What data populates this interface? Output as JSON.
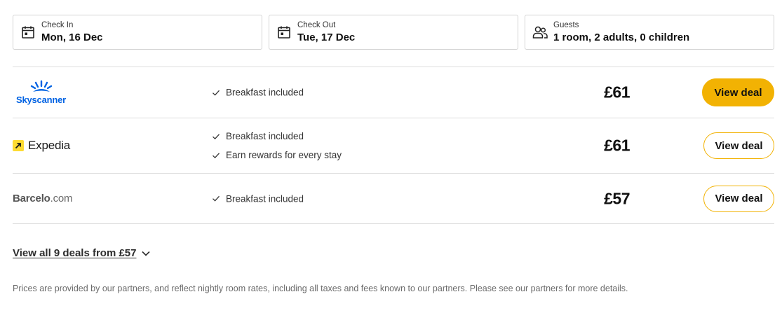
{
  "selectors": [
    {
      "label": "Check In",
      "value": "Mon, 16 Dec",
      "icon": "calendar-icon"
    },
    {
      "label": "Check Out",
      "value": "Tue, 17 Dec",
      "icon": "calendar-icon"
    },
    {
      "label": "Guests",
      "value": "1 room, 2 adults, 0 children",
      "icon": "guests-icon"
    }
  ],
  "deals": [
    {
      "provider": "Skyscanner",
      "features": [
        "Breakfast included"
      ],
      "price": "£61",
      "cta": "View deal",
      "style": "primary"
    },
    {
      "provider": "Expedia",
      "features": [
        "Breakfast included",
        "Earn rewards for every stay"
      ],
      "price": "£61",
      "cta": "View deal",
      "style": "outline"
    },
    {
      "provider_main": "Barcelo",
      "provider_domain": ".com",
      "features": [
        "Breakfast included"
      ],
      "price": "£57",
      "cta": "View deal",
      "style": "outline"
    }
  ],
  "view_all": "View all 9 deals from £57",
  "disclaimer": "Prices are provided by our partners, and reflect nightly room rates, including all taxes and fees known to our partners. Please see our partners for more details.",
  "colors": {
    "accent": "#f2b203",
    "skyscanner_blue": "#0062e3",
    "expedia_yellow": "#fddb32"
  }
}
